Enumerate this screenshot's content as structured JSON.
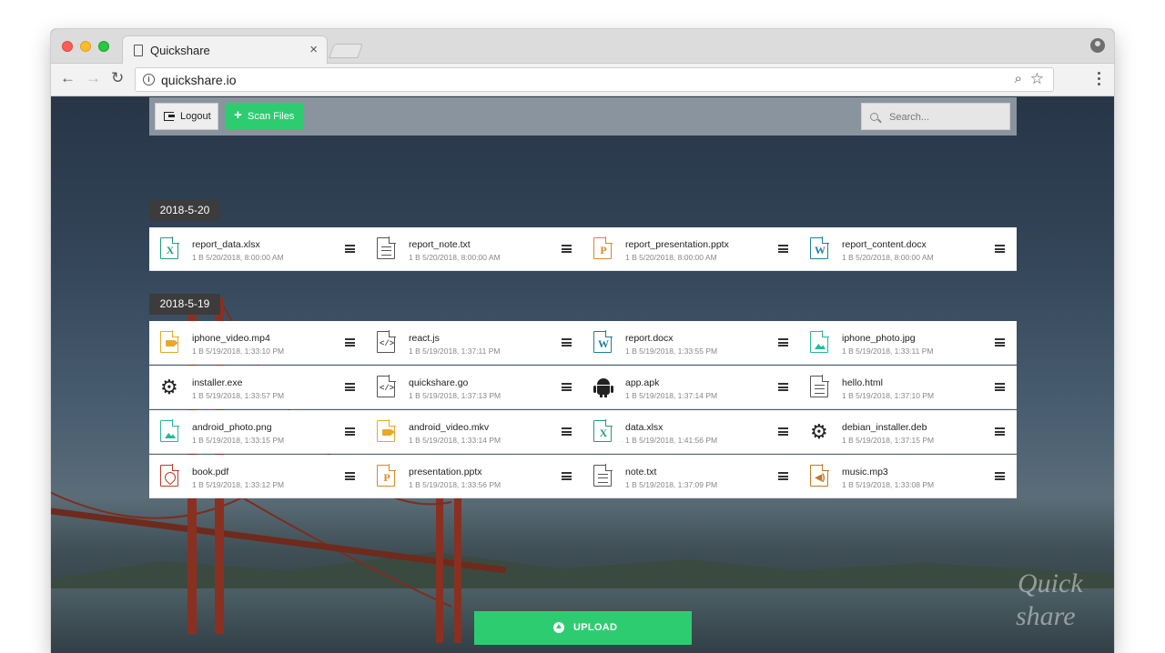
{
  "browser": {
    "tab_title": "Quickshare",
    "tab_close": "×",
    "url": "quickshare.io"
  },
  "topbar": {
    "logout_label": "Logout",
    "scan_label": "Scan Files",
    "search_placeholder": "Search..."
  },
  "groups": [
    {
      "date": "2018-5-20",
      "rows": [
        [
          {
            "name": "report_data.xlsx",
            "meta": "1 B 5/20/2018, 8:00:00 AM",
            "icon": "excel-file-icon"
          },
          {
            "name": "report_note.txt",
            "meta": "1 B 5/20/2018, 8:00:00 AM",
            "icon": "text-file-icon"
          },
          {
            "name": "report_presentation.pptx",
            "meta": "1 B 5/20/2018, 8:00:00 AM",
            "icon": "powerpoint-file-icon"
          },
          {
            "name": "report_content.docx",
            "meta": "1 B 5/20/2018, 8:00:00 AM",
            "icon": "word-file-icon"
          }
        ]
      ]
    },
    {
      "date": "2018-5-19",
      "rows": [
        [
          {
            "name": "iphone_video.mp4",
            "meta": "1 B 5/19/2018, 1:33:10 PM",
            "icon": "video-file-icon"
          },
          {
            "name": "react.js",
            "meta": "1 B 5/19/2018, 1:37:11 PM",
            "icon": "code-file-icon"
          },
          {
            "name": "report.docx",
            "meta": "1 B 5/19/2018, 1:33:55 PM",
            "icon": "word-file-icon"
          },
          {
            "name": "iphone_photo.jpg",
            "meta": "1 B 5/19/2018, 1:33:11 PM",
            "icon": "image-file-icon"
          }
        ],
        [
          {
            "name": "installer.exe",
            "meta": "1 B 5/19/2018, 1:33:57 PM",
            "icon": "gear-icon"
          },
          {
            "name": "quickshare.go",
            "meta": "1 B 5/19/2018, 1:37:13 PM",
            "icon": "code-file-icon"
          },
          {
            "name": "app.apk",
            "meta": "1 B 5/19/2018, 1:37:14 PM",
            "icon": "android-icon"
          },
          {
            "name": "hello.html",
            "meta": "1 B 5/19/2018, 1:37:10 PM",
            "icon": "text-file-icon"
          }
        ],
        [
          {
            "name": "android_photo.png",
            "meta": "1 B 5/19/2018, 1:33:15 PM",
            "icon": "image-file-icon"
          },
          {
            "name": "android_video.mkv",
            "meta": "1 B 5/19/2018, 1:33:14 PM",
            "icon": "video-file-icon"
          },
          {
            "name": "data.xlsx",
            "meta": "1 B 5/19/2018, 1:41:56 PM",
            "icon": "excel-file-icon"
          },
          {
            "name": "debian_installer.deb",
            "meta": "1 B 5/19/2018, 1:37:15 PM",
            "icon": "gear-icon"
          }
        ],
        [
          {
            "name": "book.pdf",
            "meta": "1 B 5/19/2018, 1:33:12 PM",
            "icon": "pdf-file-icon"
          },
          {
            "name": "presentation.pptx",
            "meta": "1 B 5/19/2018, 1:33:56 PM",
            "icon": "powerpoint-file-icon"
          },
          {
            "name": "note.txt",
            "meta": "1 B 5/19/2018, 1:37:09 PM",
            "icon": "text-file-icon"
          },
          {
            "name": "music.mp3",
            "meta": "1 B 5/19/2018, 1:33:08 PM",
            "icon": "audio-file-icon"
          }
        ]
      ]
    }
  ],
  "upload_label": "UPLOAD",
  "watermark": "Quick share",
  "colors": {
    "accent": "#2ecc71",
    "topbar": "#8a949e",
    "date_label": "#3c3c3c",
    "excel": "#1f9e7e",
    "word": "#1d7f9e",
    "powerpoint": "#d8892c",
    "video": "#e8a82a",
    "image": "#26b89a",
    "pdf": "#c0392b",
    "audio": "#c0782a",
    "text": "#555555"
  }
}
